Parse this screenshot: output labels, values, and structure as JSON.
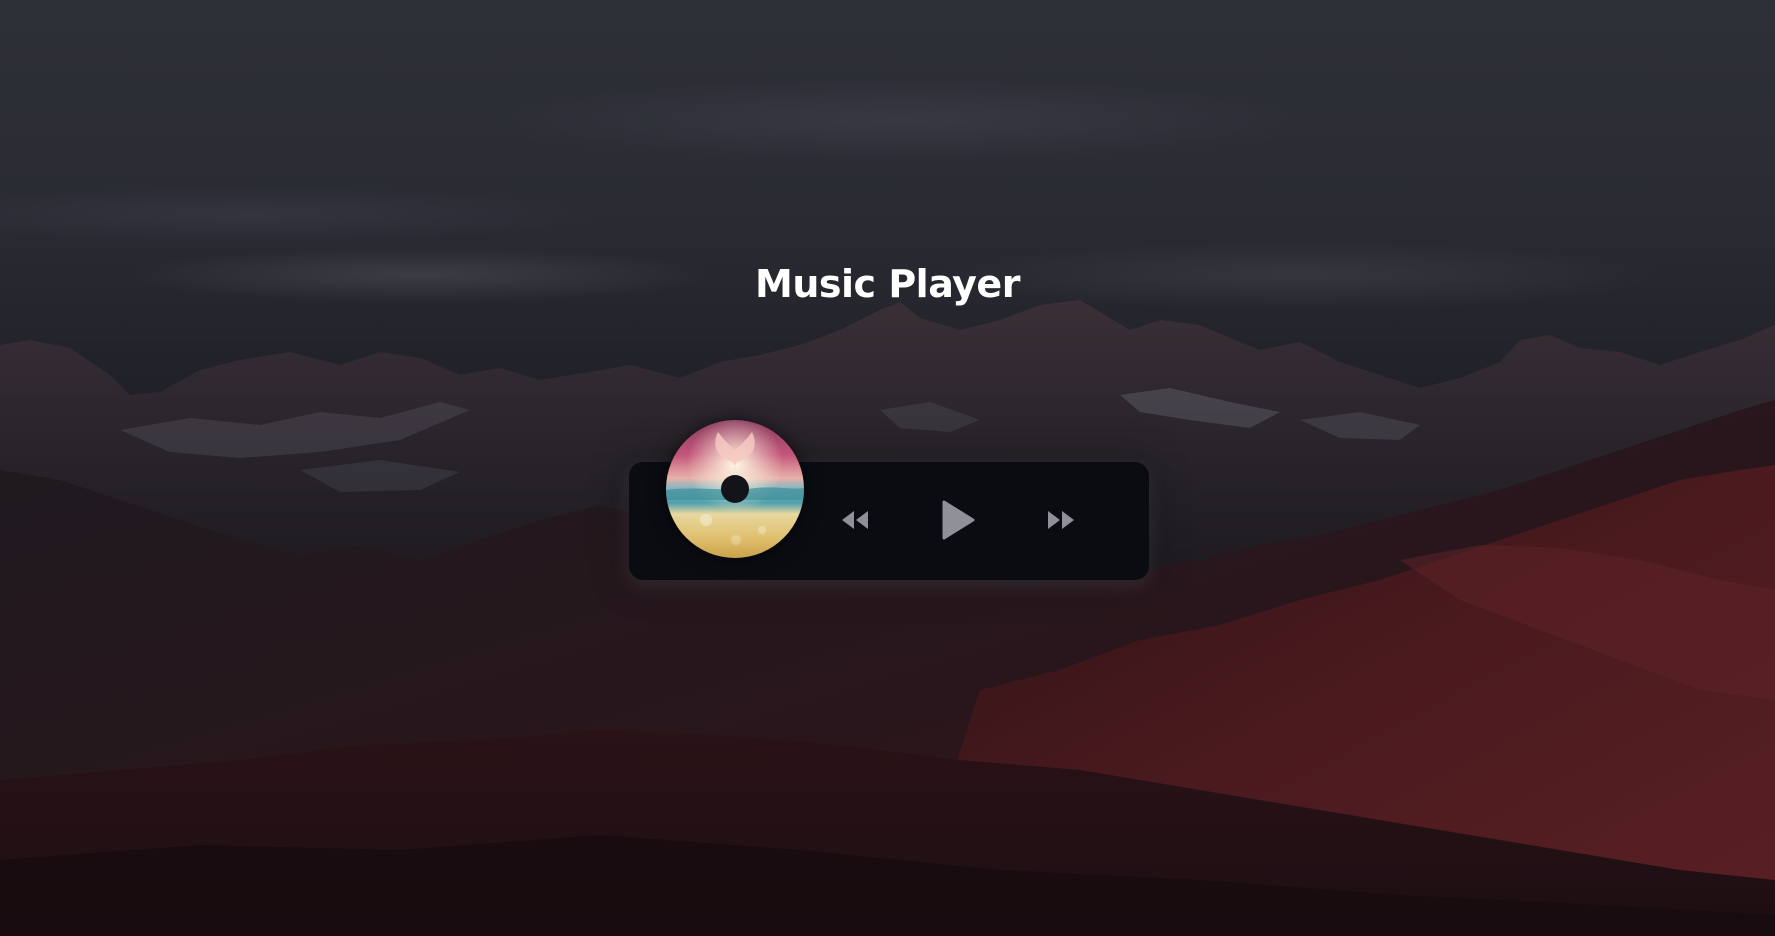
{
  "app": {
    "title": "Music Player"
  },
  "player": {
    "state": "paused",
    "controls": [
      {
        "name": "previous",
        "icon": "backward-icon"
      },
      {
        "name": "play",
        "icon": "play-icon"
      },
      {
        "name": "next",
        "icon": "forward-icon"
      }
    ],
    "album_art_icon": "album-disc"
  },
  "colors": {
    "panel": "#0b0c12",
    "control_icon": "#8f9098",
    "title_text": "#ffffff"
  }
}
